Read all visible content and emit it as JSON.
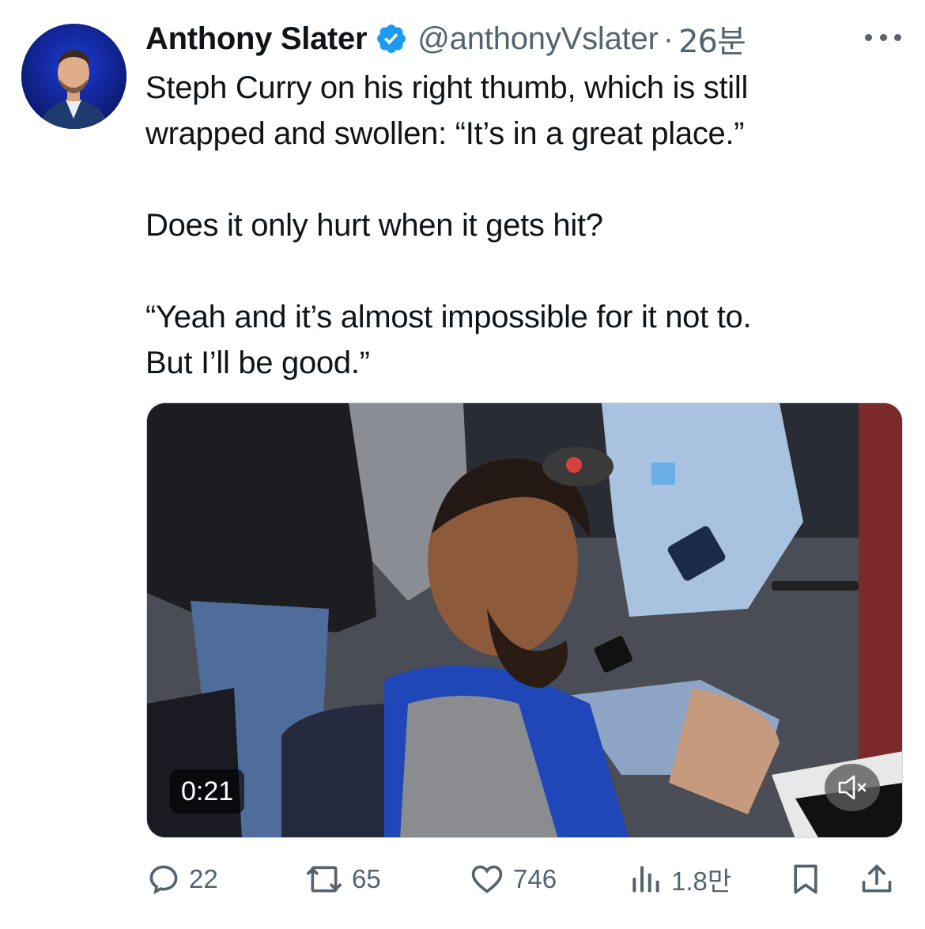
{
  "author": {
    "display_name": "Anthony Slater",
    "handle": "@anthonyVslater",
    "separator": "·",
    "time": "26분",
    "verified": true,
    "verified_color": "#1d9bf0"
  },
  "tweet": {
    "lines": [
      "Steph Curry on his right thumb, which is still",
      "wrapped and swollen: “It’s in a great place.”",
      "",
      "Does it only hurt when it gets hit?",
      "",
      "“Yeah and it’s almost impossible for it not to.",
      "But I’ll be good.”"
    ]
  },
  "media": {
    "type": "video",
    "duration": "0:21",
    "muted": true
  },
  "actions": {
    "replies": "22",
    "reposts": "65",
    "likes": "746",
    "views": "1.8만"
  },
  "colors": {
    "text": "#0f1419",
    "secondary": "#536471",
    "verified": "#1d9bf0"
  }
}
